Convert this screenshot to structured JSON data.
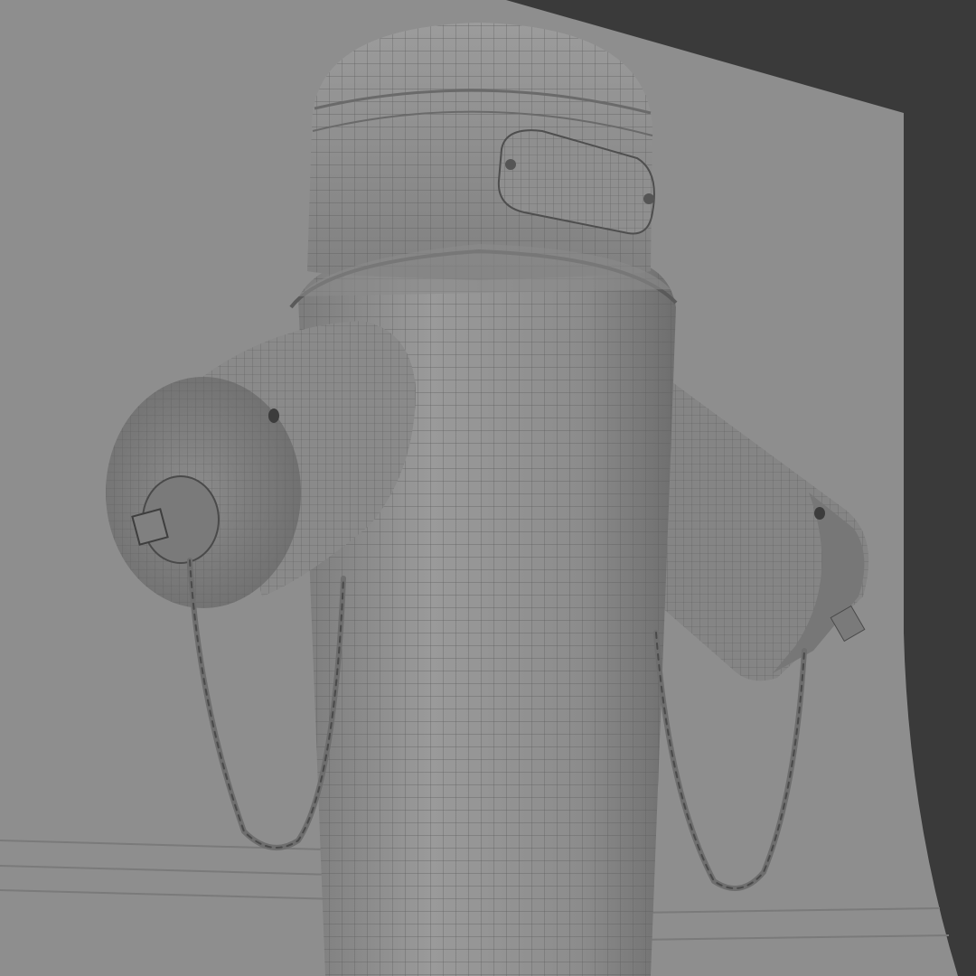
{
  "scene": {
    "subject": "fire-hydrant-wireframe",
    "background_color": "#3a3a3a",
    "backdrop_color": "#8e8e8e",
    "body_color": "#8a8a8a",
    "wire_color": "#5e5e5e",
    "shadow_color": "#6a6a6a",
    "chain_color": "#707070"
  }
}
